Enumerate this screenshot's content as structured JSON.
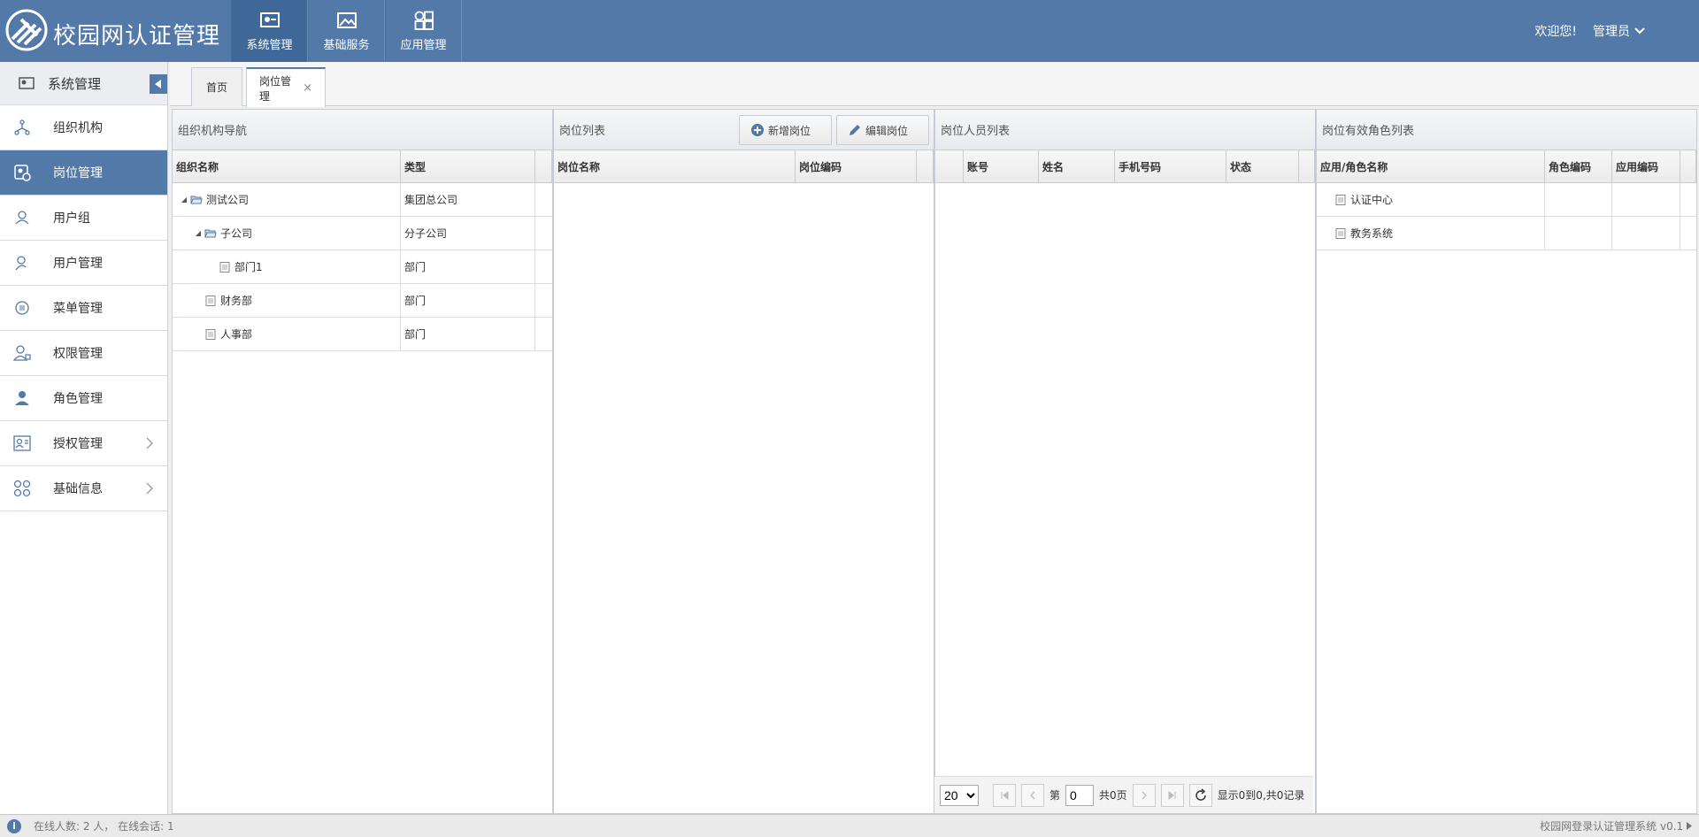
{
  "app": {
    "title": "校园网认证管理"
  },
  "top_nav": [
    {
      "label": "系统管理",
      "icon": "system-icon"
    },
    {
      "label": "基础服务",
      "icon": "image-icon"
    },
    {
      "label": "应用管理",
      "icon": "apps-icon"
    }
  ],
  "header": {
    "welcome": "欢迎您!",
    "user": "管理员"
  },
  "sidebar": {
    "title": "系统管理",
    "items": [
      {
        "label": "组织机构",
        "icon": "org-icon"
      },
      {
        "label": "岗位管理",
        "icon": "post-icon"
      },
      {
        "label": "用户组",
        "icon": "user-group-icon"
      },
      {
        "label": "用户管理",
        "icon": "user-icon"
      },
      {
        "label": "菜单管理",
        "icon": "menu-icon"
      },
      {
        "label": "权限管理",
        "icon": "permission-icon"
      },
      {
        "label": "角色管理",
        "icon": "role-icon"
      },
      {
        "label": "授权管理",
        "icon": "authorize-icon"
      },
      {
        "label": "基础信息",
        "icon": "basic-info-icon"
      }
    ]
  },
  "tabs": [
    {
      "label": "首页"
    },
    {
      "label": "岗位管理",
      "close": "×"
    }
  ],
  "org_panel": {
    "title": "组织机构导航",
    "columns": [
      "组织名称",
      "类型"
    ],
    "rows": [
      {
        "name": "测试公司",
        "type": "集团总公司",
        "toggle": "◢"
      },
      {
        "name": "子公司",
        "type": "分子公司",
        "toggle": "◢"
      },
      {
        "name": "部门1",
        "type": "部门"
      },
      {
        "name": "财务部",
        "type": "部门"
      },
      {
        "name": "人事部",
        "type": "部门"
      }
    ]
  },
  "post_panel": {
    "title": "岗位列表",
    "add_button": "新增岗位",
    "edit_button": "编辑岗位",
    "columns": [
      "岗位名称",
      "岗位编码"
    ]
  },
  "staff_panel": {
    "title": "岗位人员列表",
    "columns": [
      "账号",
      "姓名",
      "手机号码",
      "状态"
    ],
    "pager": {
      "page_size": "20",
      "page_prefix": "第",
      "page_value": "0",
      "page_total": "共0页",
      "summary": "显示0到0,共0记录"
    }
  },
  "role_panel": {
    "title": "岗位有效角色列表",
    "columns": [
      "应用/角色名称",
      "角色编码",
      "应用编码"
    ],
    "rows": [
      {
        "name": "认证中心"
      },
      {
        "name": "教务系统"
      }
    ]
  },
  "footer": {
    "status": "在线人数: 2 人， 在线会话: 1",
    "version": "校园网登录认证管理系统 v0.1"
  }
}
